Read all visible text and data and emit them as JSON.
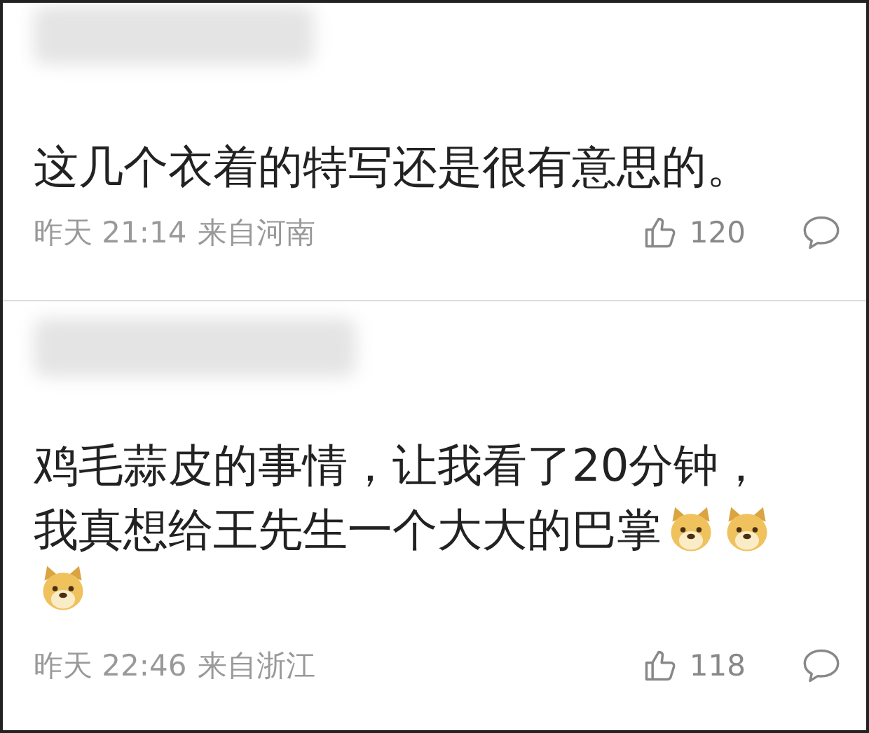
{
  "comments": [
    {
      "lines": [
        [
          {
            "kind": "text",
            "text": "这几个衣着的特写还是很有意思的。"
          }
        ]
      ],
      "time": "昨天 21:14",
      "source": "来自河南",
      "likes": "120"
    },
    {
      "lines": [
        [
          {
            "kind": "text",
            "text": "鸡毛蒜皮的事情，让我看了20分钟，"
          }
        ],
        [
          {
            "kind": "text",
            "text": "我真想给王先生一个大大的巴掌"
          },
          {
            "kind": "emoji"
          },
          {
            "kind": "emoji"
          }
        ],
        [
          {
            "kind": "emoji"
          }
        ]
      ],
      "time": "昨天 22:46",
      "source": "来自浙江",
      "likes": "118"
    }
  ]
}
